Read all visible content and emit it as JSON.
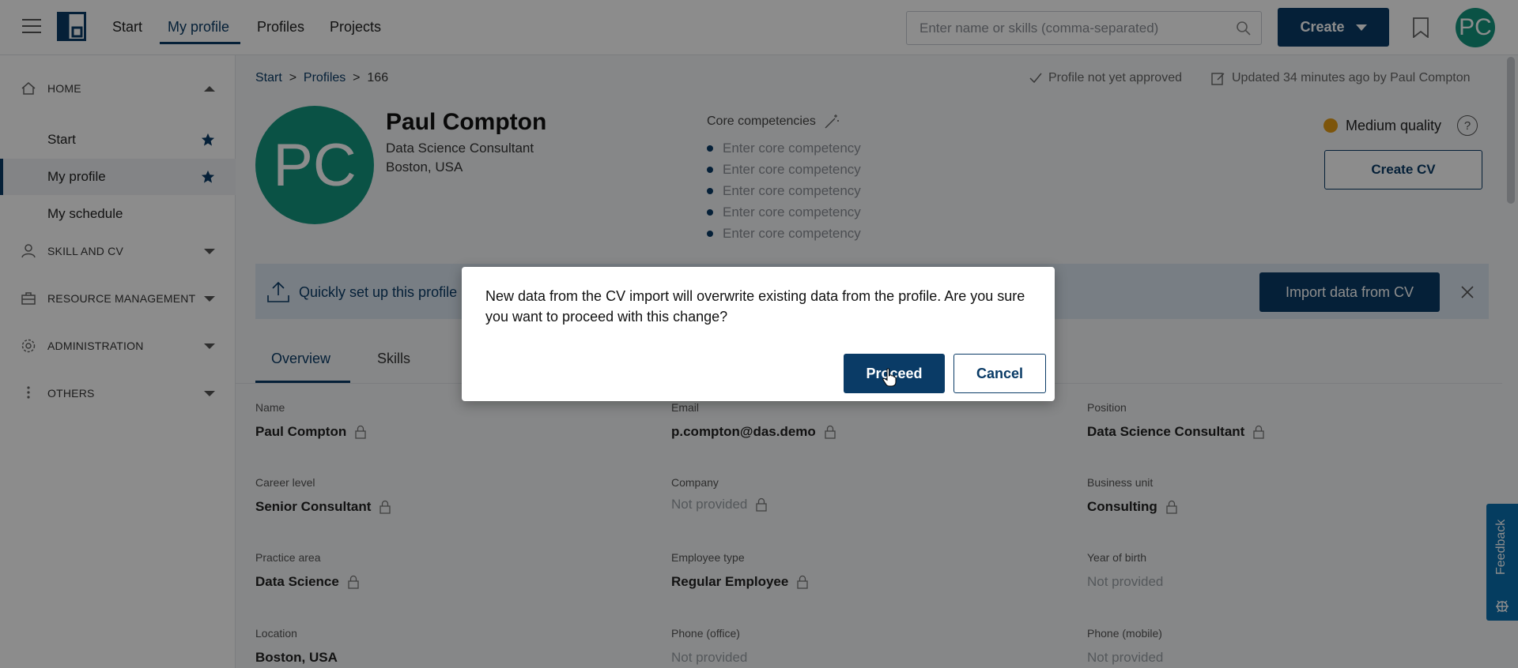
{
  "nav": {
    "items": [
      "Start",
      "My profile",
      "Profiles",
      "Projects"
    ],
    "active": "My profile",
    "search_placeholder": "Enter name or skills (comma-separated)",
    "create_label": "Create",
    "avatar_initials": "PC"
  },
  "sidebar": {
    "sections": [
      {
        "label": "HOME",
        "icon": "home-icon",
        "expanded": true
      },
      {
        "label": "SKILL AND CV",
        "icon": "person-icon",
        "expanded": false
      },
      {
        "label": "RESOURCE MANAGEMENT",
        "icon": "briefcase-icon",
        "expanded": false
      },
      {
        "label": "ADMINISTRATION",
        "icon": "gear-icon",
        "expanded": false
      },
      {
        "label": "OTHERS",
        "icon": "more-vertical-icon",
        "expanded": false
      }
    ],
    "home_items": [
      {
        "label": "Start",
        "starred": true
      },
      {
        "label": "My profile",
        "starred": true,
        "active": true
      },
      {
        "label": "My schedule",
        "starred": false
      }
    ]
  },
  "breadcrumb": {
    "start": "Start",
    "profiles": "Profiles",
    "id": "166",
    "sep": ">"
  },
  "status": {
    "approval": "Profile not yet approved",
    "updated": "Updated 34 minutes ago by Paul Compton"
  },
  "profile": {
    "initials": "PC",
    "name": "Paul Compton",
    "title": "Data Science Consultant",
    "location": "Boston, USA"
  },
  "core": {
    "title": "Core competencies",
    "placeholders": [
      "Enter core competency",
      "Enter core competency",
      "Enter core competency",
      "Enter core competency",
      "Enter core competency"
    ]
  },
  "quality": {
    "label": "Medium quality",
    "color": "#e39c14",
    "help": "?"
  },
  "create_cv_label": "Create CV",
  "import": {
    "text": "Quickly set up this profile",
    "button": "Import data from CV"
  },
  "tabs": [
    "Overview",
    "Skills"
  ],
  "fields": [
    {
      "label": "Name",
      "value": "Paul Compton",
      "locked": true,
      "empty": false
    },
    {
      "label": "Email",
      "value": "p.compton@das.demo",
      "locked": true,
      "empty": false
    },
    {
      "label": "Position",
      "value": "Data Science Consultant",
      "locked": true,
      "empty": false
    },
    {
      "label": "Career level",
      "value": "Senior Consultant",
      "locked": true,
      "empty": false
    },
    {
      "label": "Company",
      "value": "Not provided",
      "locked": true,
      "empty": true
    },
    {
      "label": "Business unit",
      "value": "Consulting",
      "locked": true,
      "empty": false
    },
    {
      "label": "Practice area",
      "value": "Data Science",
      "locked": true,
      "empty": false
    },
    {
      "label": "Employee type",
      "value": "Regular Employee",
      "locked": true,
      "empty": false
    },
    {
      "label": "Year of birth",
      "value": "Not provided",
      "locked": false,
      "empty": true
    },
    {
      "label": "Location",
      "value": "Boston, USA",
      "locked": false,
      "empty": false
    },
    {
      "label": "Phone (office)",
      "value": "Not provided",
      "locked": false,
      "empty": true
    },
    {
      "label": "Phone (mobile)",
      "value": "Not provided",
      "locked": false,
      "empty": true
    }
  ],
  "feedback_label": "Feedback",
  "dialog": {
    "message": "New data from the CV import will overwrite existing data from the profile. Are you sure you want to proceed with this change?",
    "proceed": "Proceed",
    "cancel": "Cancel"
  },
  "colors": {
    "brand": "#0a3b66",
    "avatar": "#13967f",
    "overlay": "rgba(0,0,0,0.45)"
  }
}
